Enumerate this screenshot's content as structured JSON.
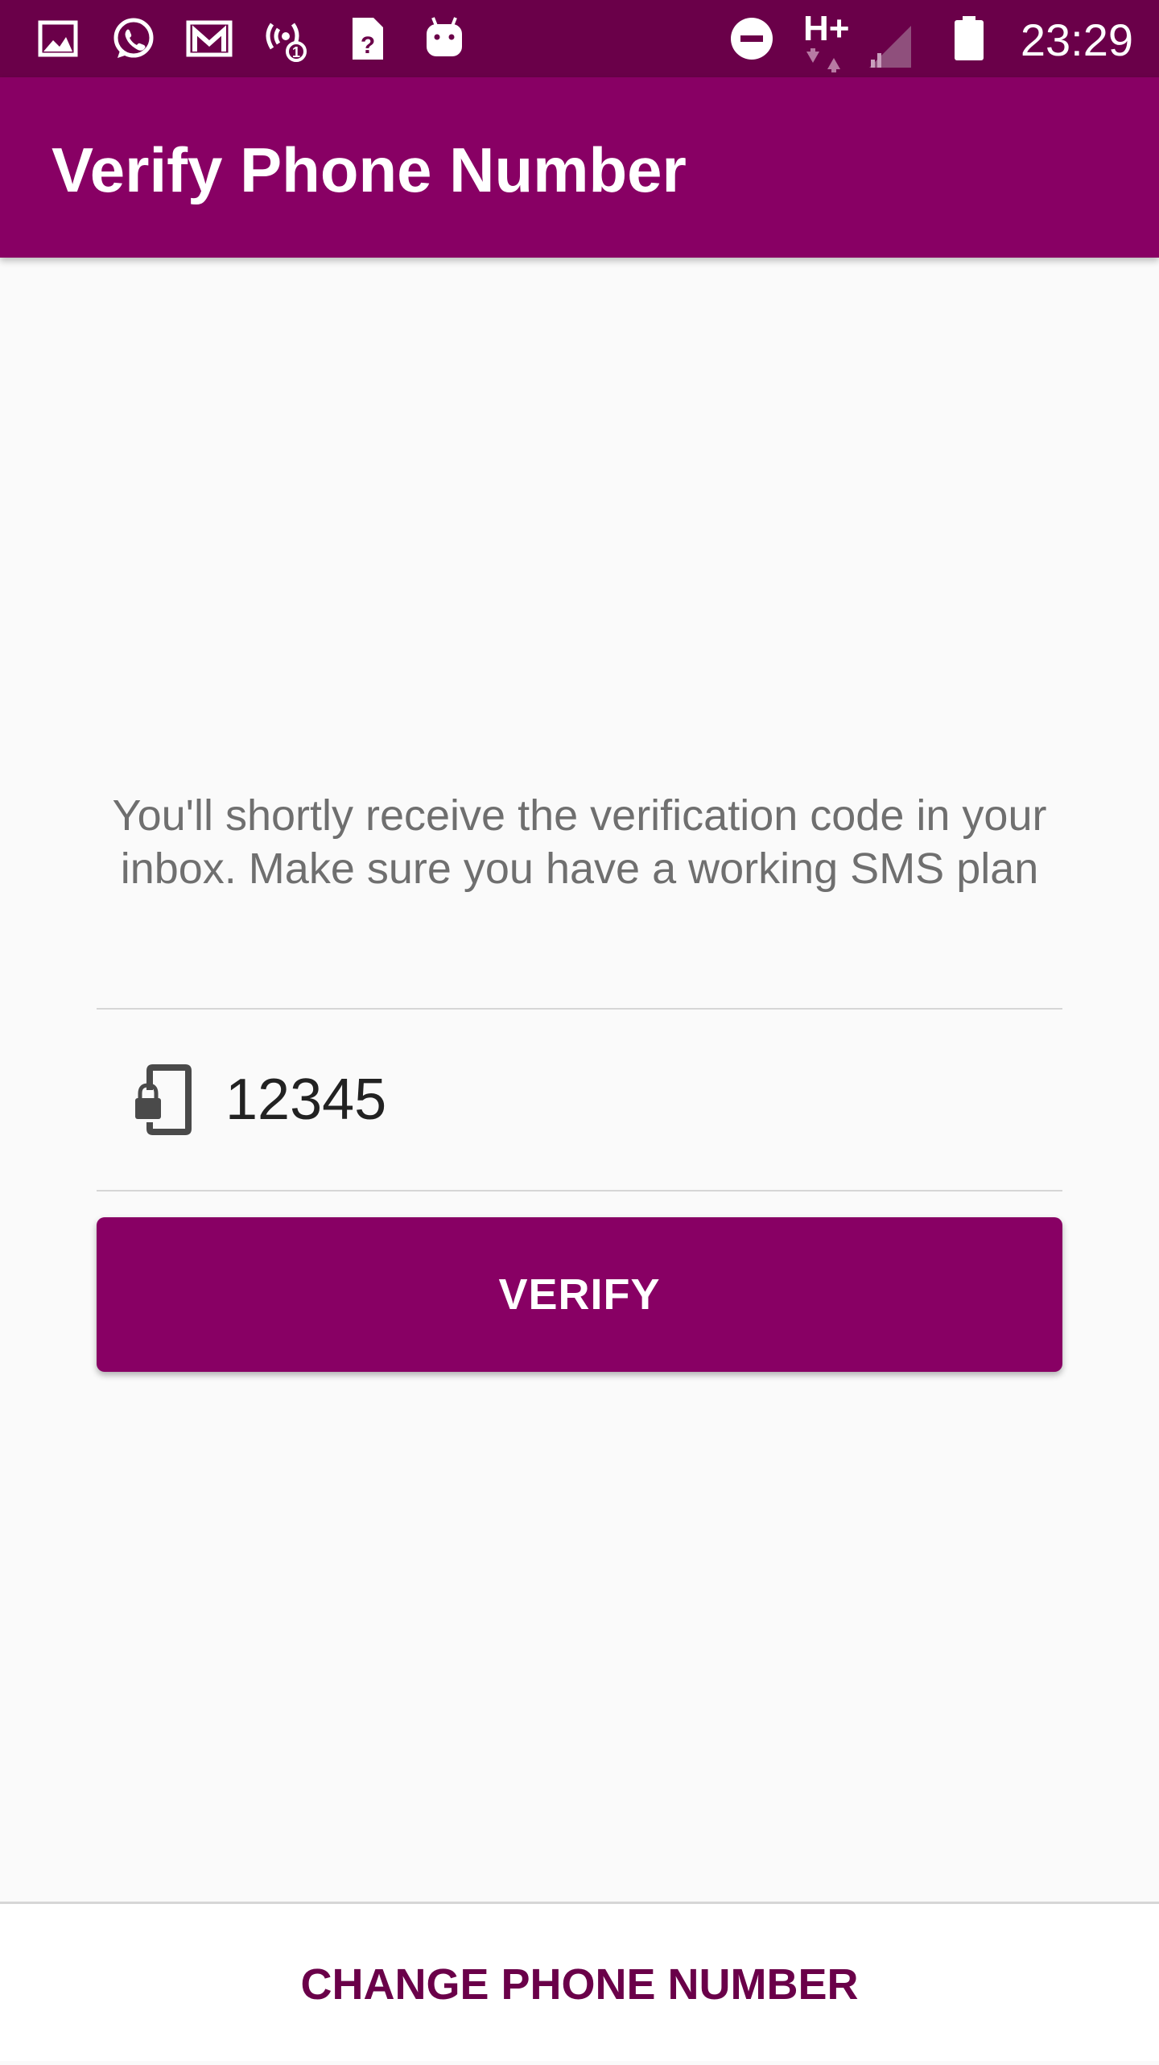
{
  "status_bar": {
    "time": "23:29",
    "network_label": "H+",
    "left_icons": [
      "image-icon",
      "whatsapp-icon",
      "gmail-icon",
      "hotspot-icon",
      "sim-unknown-icon",
      "android-icon"
    ],
    "right_icons": [
      "do-not-disturb-icon",
      "network-type-icon",
      "signal-icon",
      "battery-icon"
    ]
  },
  "app_bar": {
    "title": "Verify Phone Number"
  },
  "main": {
    "message": "You'll shortly receive the verification code in your inbox. Make sure you have a working SMS plan",
    "code_field": {
      "value": "12345",
      "icon": "phone-lock-icon"
    },
    "verify_button_label": "VERIFY"
  },
  "bottom": {
    "change_phone_label": "CHANGE PHONE NUMBER"
  },
  "colors": {
    "status_bar": "#6a0049",
    "primary": "#880064",
    "accent_text": "#6a0049",
    "background": "#fafafa"
  }
}
